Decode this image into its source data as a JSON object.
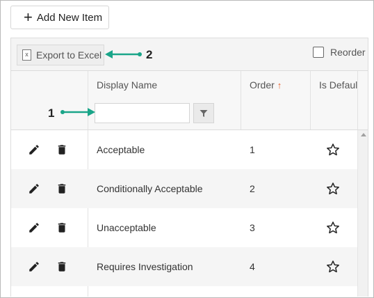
{
  "toolbar": {
    "add_label": "Add New Item"
  },
  "grid": {
    "export_label": "Export to Excel",
    "reorder_label": "Reorder",
    "columns": {
      "display_name": "Display Name",
      "order": "Order",
      "is_default": "Is Defaul"
    },
    "sort_indicator": "↑",
    "rows": [
      {
        "name": "Acceptable",
        "order": "1"
      },
      {
        "name": "Conditionally Acceptable",
        "order": "2"
      },
      {
        "name": "Unacceptable",
        "order": "3"
      },
      {
        "name": "Requires Investigation",
        "order": "4"
      }
    ]
  },
  "annotations": {
    "callout_1": "1",
    "callout_2": "2"
  },
  "colors": {
    "annotation_arrow": "#1aa589",
    "sort_arrow": "#e85d2a"
  }
}
